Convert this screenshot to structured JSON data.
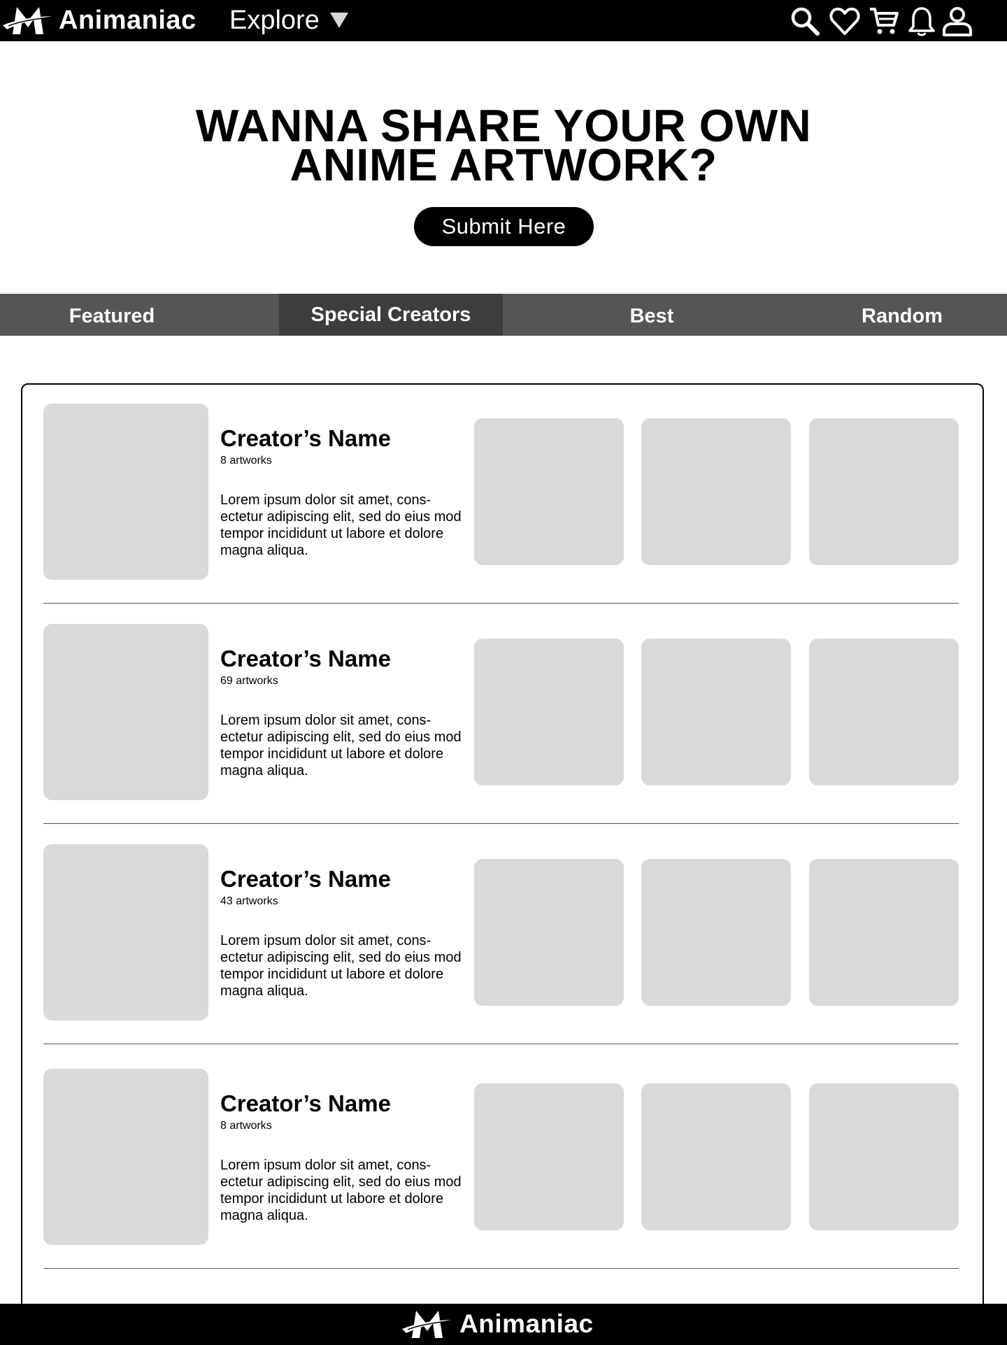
{
  "navbar": {
    "brand_name": "Animaniac",
    "explore_label": "Explore",
    "icons": [
      "search-icon",
      "heart-icon",
      "cart-icon",
      "bell-icon",
      "user-icon"
    ]
  },
  "hero": {
    "title_line1": "WANNA SHARE YOUR OWN",
    "title_line2": "ANIME ARTWORK?",
    "submit_label": "Submit Here"
  },
  "tabs": [
    {
      "label": "Featured",
      "active": false
    },
    {
      "label": "Special Creators",
      "active": true
    },
    {
      "label": "Best",
      "active": false
    },
    {
      "label": "Random",
      "active": false
    }
  ],
  "creators": [
    {
      "name": "Creator’s Name",
      "count": "8 artworks",
      "bio": "Lorem ipsum dolor sit amet, cons-ectetur adipiscing elit, sed do eius mod tempor incididunt ut labore et dolore magna aliqua."
    },
    {
      "name": "Creator’s Name",
      "count": "69 artworks",
      "bio": "Lorem ipsum dolor sit amet, cons-ectetur adipiscing elit, sed do eius mod tempor incididunt ut labore et dolore magna aliqua."
    },
    {
      "name": "Creator’s Name",
      "count": "43 artworks",
      "bio": "Lorem ipsum dolor sit amet, cons-ectetur adipiscing elit, sed do eius mod tempor incididunt ut labore et dolore magna aliqua."
    },
    {
      "name": "Creator’s Name",
      "count": "8 artworks",
      "bio": "Lorem ipsum dolor sit amet, cons-ectetur adipiscing elit, sed do eius mod tempor incididunt ut labore et dolore magna aliqua."
    }
  ],
  "footer": {
    "brand_name": "Animaniac"
  },
  "colors": {
    "bar": "#000000",
    "tab_bar": "#555555",
    "tab_active": "#3d3d3d",
    "placeholder": "#d9d9d9"
  }
}
